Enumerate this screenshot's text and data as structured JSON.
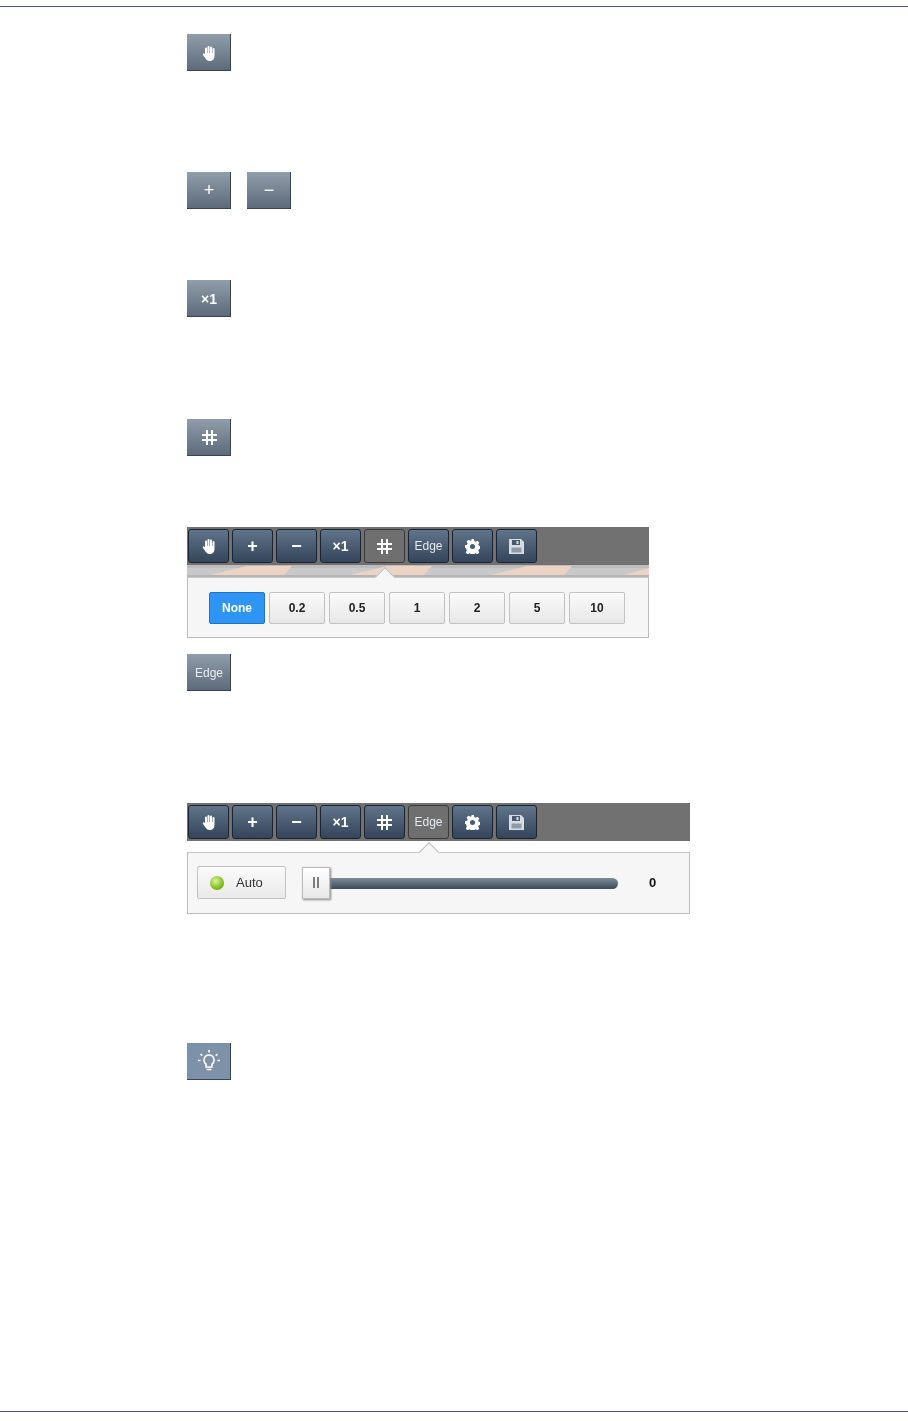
{
  "sections": [
    {
      "kind": "buttons",
      "buttons": [
        {
          "kind": "hand"
        }
      ]
    },
    {
      "kind": "buttons",
      "buttons": [
        {
          "kind": "text",
          "label": "+"
        },
        {
          "kind": "text",
          "label": "−"
        }
      ]
    },
    {
      "kind": "buttons",
      "buttons": [
        {
          "kind": "text",
          "label": "×1"
        }
      ]
    },
    {
      "kind": "buttons",
      "buttons": [
        {
          "kind": "grid"
        }
      ]
    },
    {
      "kind": "toolbar",
      "tools": [
        {
          "kind": "hand",
          "selected": false
        },
        {
          "kind": "text",
          "label": "+",
          "selected": false
        },
        {
          "kind": "text",
          "label": "−",
          "selected": false
        },
        {
          "kind": "text",
          "label": "×1",
          "selected": false
        },
        {
          "kind": "grid",
          "selected": true
        },
        {
          "kind": "word",
          "label": "Edge",
          "selected": false
        },
        {
          "kind": "gear",
          "selected": false
        },
        {
          "kind": "save",
          "selected": false
        }
      ],
      "popup": {
        "kind": "options",
        "options": [
          {
            "label": "None",
            "selected": true
          },
          {
            "label": "0.2",
            "selected": false
          },
          {
            "label": "0.5",
            "selected": false
          },
          {
            "label": "1",
            "selected": false
          },
          {
            "label": "2",
            "selected": false
          },
          {
            "label": "5",
            "selected": false
          },
          {
            "label": "10",
            "selected": false
          }
        ]
      }
    },
    {
      "kind": "buttons",
      "buttons": [
        {
          "kind": "word",
          "label": "Edge"
        }
      ]
    },
    {
      "kind": "toolbar",
      "tools": [
        {
          "kind": "hand",
          "selected": false
        },
        {
          "kind": "text",
          "label": "+",
          "selected": false
        },
        {
          "kind": "text",
          "label": "−",
          "selected": false
        },
        {
          "kind": "text",
          "label": "×1",
          "selected": false
        },
        {
          "kind": "grid",
          "selected": false
        },
        {
          "kind": "word",
          "label": "Edge",
          "selected": true
        },
        {
          "kind": "gear",
          "selected": false
        },
        {
          "kind": "save",
          "selected": false
        }
      ],
      "popup": {
        "kind": "slider",
        "auto": {
          "label": "Auto",
          "on": true
        },
        "slider": {
          "level": 0
        },
        "reading": "0"
      }
    },
    {
      "kind": "buttons",
      "buttons": [
        {
          "kind": "bulb"
        }
      ]
    }
  ]
}
